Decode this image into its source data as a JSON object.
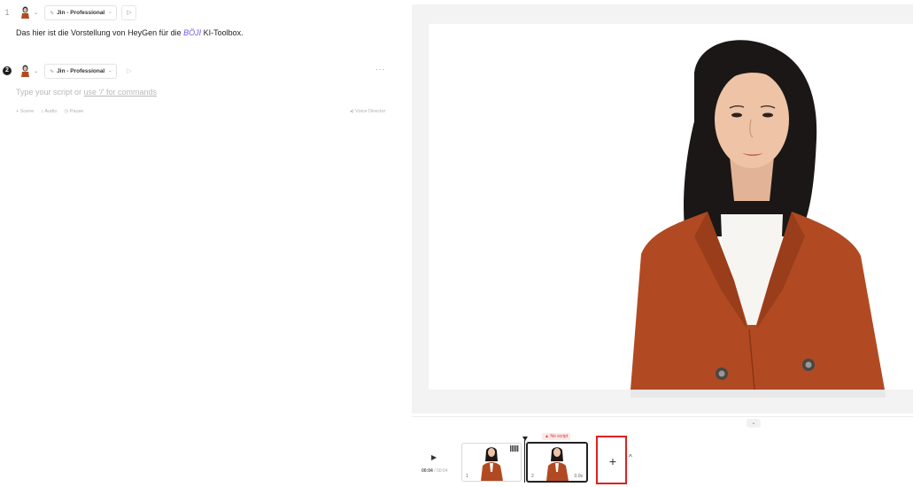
{
  "scenes": [
    {
      "number": "1",
      "voice": "Jin - Professional",
      "script_before": "Das hier ist die Vorstellung von HeyGen für die ",
      "script_brand": "BÖJI",
      "script_after": " KI-Toolbox."
    },
    {
      "number": "2",
      "voice": "Jin - Professional",
      "placeholder_prefix": "Type your script or ",
      "placeholder_link": "use '/' for commands"
    }
  ],
  "editor_tools": {
    "scene": "+ Scene",
    "audio": "Audio",
    "pause": "Pause",
    "voice_director": "Voice Director",
    "more": "···"
  },
  "timeline": {
    "current_time": "00:04",
    "total_time": "/ 00:04",
    "no_script_label": "No script",
    "thumbs": [
      {
        "num": "1",
        "duration": ""
      },
      {
        "num": "2",
        "duration": "0.0s"
      }
    ],
    "add_label": "+",
    "expand_label": "^",
    "collapse_label": "⌄"
  },
  "colors": {
    "brand_text": "#6d5ae6",
    "highlight_box": "#e0201e",
    "warning": "#d23b3b",
    "blazer": "#b14a22"
  },
  "icons": {
    "play": "play-icon",
    "voice": "waveform-icon",
    "add": "plus-icon"
  }
}
